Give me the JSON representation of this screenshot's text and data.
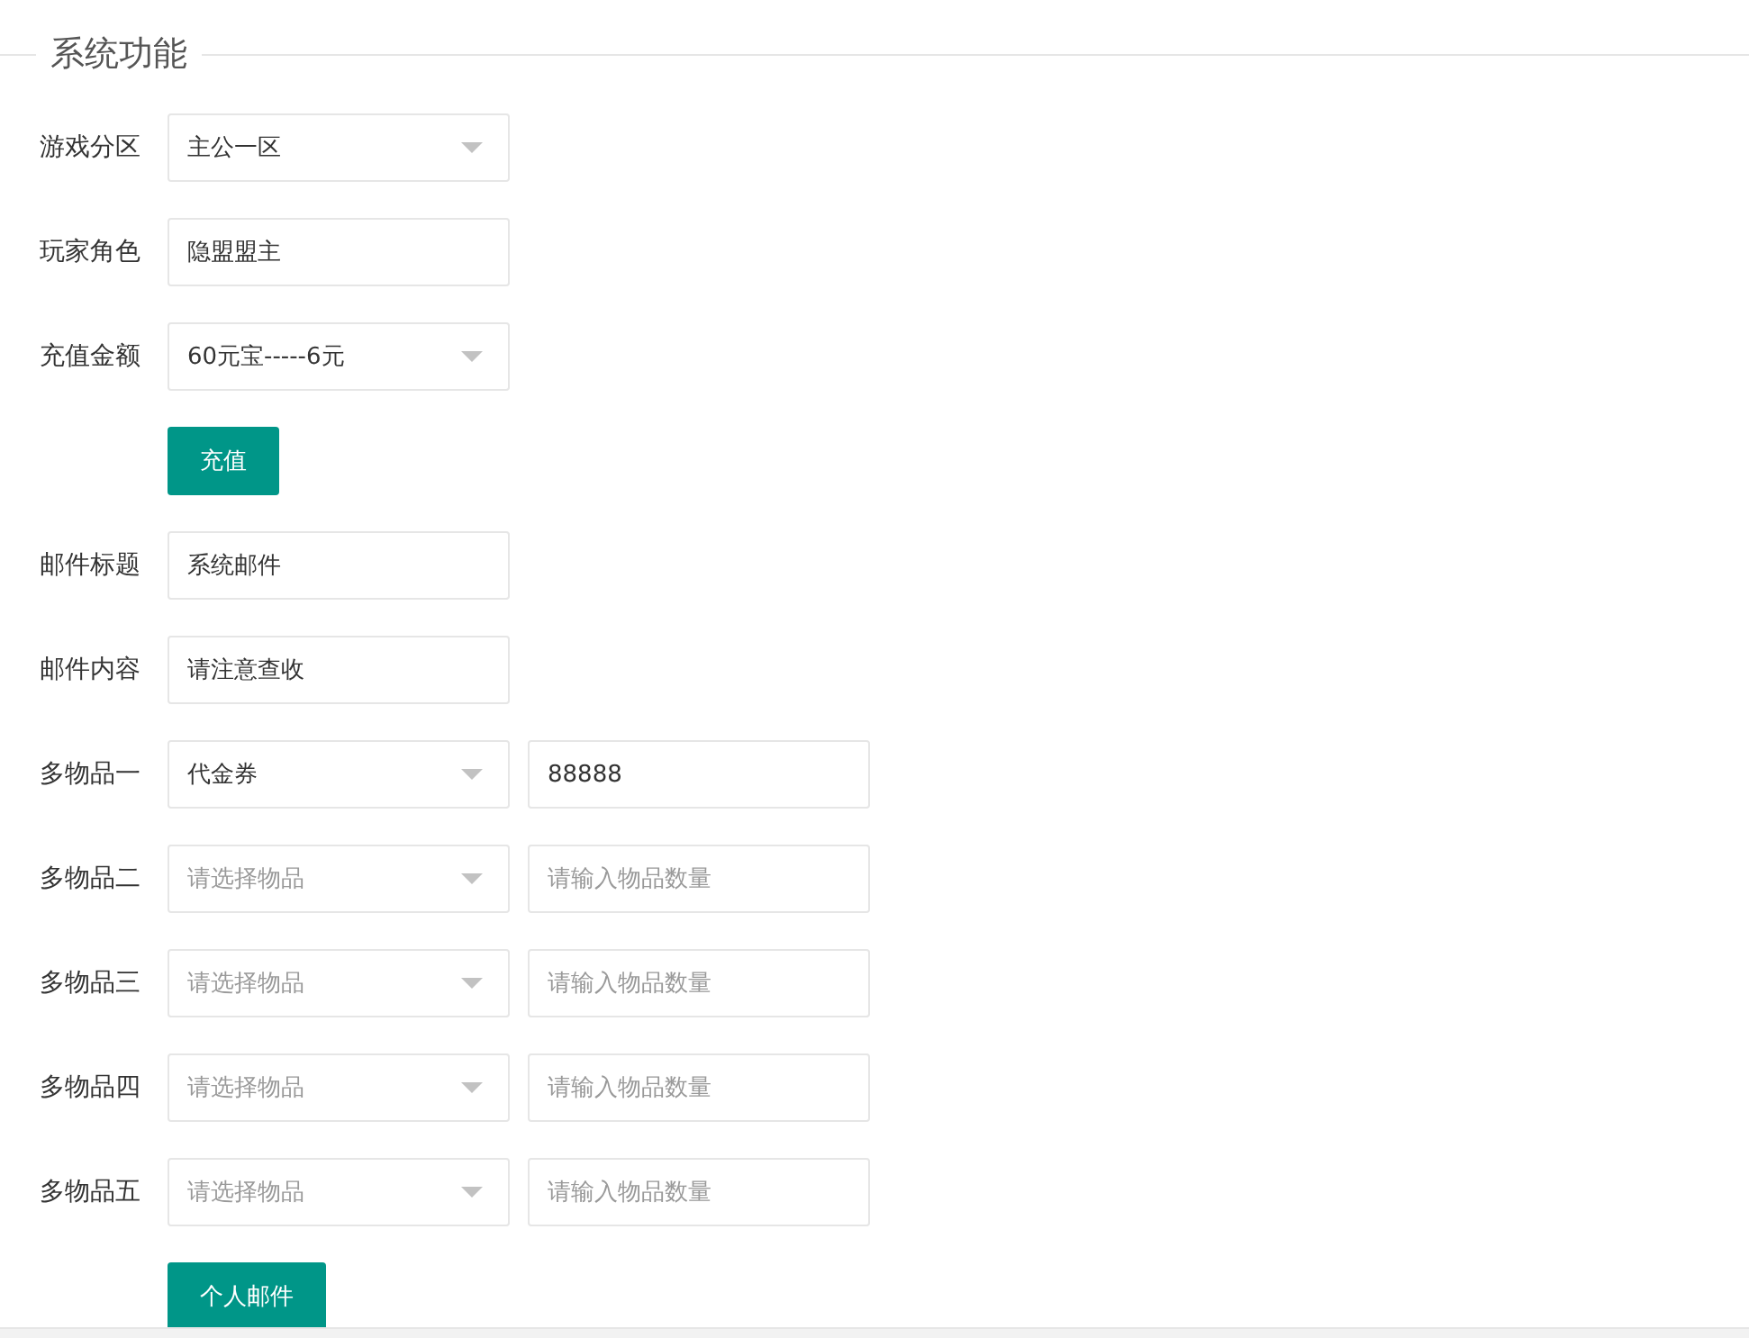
{
  "section": {
    "title": "系统功能"
  },
  "rows": [
    {
      "kind": "select",
      "label": "游戏分区",
      "value": "主公一区"
    },
    {
      "kind": "text",
      "label": "玩家角色",
      "value": "隐盟盟主"
    },
    {
      "kind": "select",
      "label": "充值金额",
      "value": "60元宝-----6元"
    },
    {
      "kind": "button",
      "text": "充值"
    },
    {
      "kind": "text",
      "label": "邮件标题",
      "value": "系统邮件"
    },
    {
      "kind": "text",
      "label": "邮件内容",
      "value": "请注意查收"
    },
    {
      "kind": "item",
      "label": "多物品一",
      "item": {
        "value": "代金券"
      },
      "quantity": {
        "value": "88888"
      }
    },
    {
      "kind": "item",
      "label": "多物品二",
      "item": {
        "placeholder": "请选择物品"
      },
      "quantity": {
        "placeholder": "请输入物品数量"
      }
    },
    {
      "kind": "item",
      "label": "多物品三",
      "item": {
        "placeholder": "请选择物品"
      },
      "quantity": {
        "placeholder": "请输入物品数量"
      }
    },
    {
      "kind": "item",
      "label": "多物品四",
      "item": {
        "placeholder": "请选择物品"
      },
      "quantity": {
        "placeholder": "请输入物品数量"
      }
    },
    {
      "kind": "item",
      "label": "多物品五",
      "item": {
        "placeholder": "请选择物品"
      },
      "quantity": {
        "placeholder": "请输入物品数量"
      }
    },
    {
      "kind": "button",
      "text": "个人邮件"
    }
  ]
}
